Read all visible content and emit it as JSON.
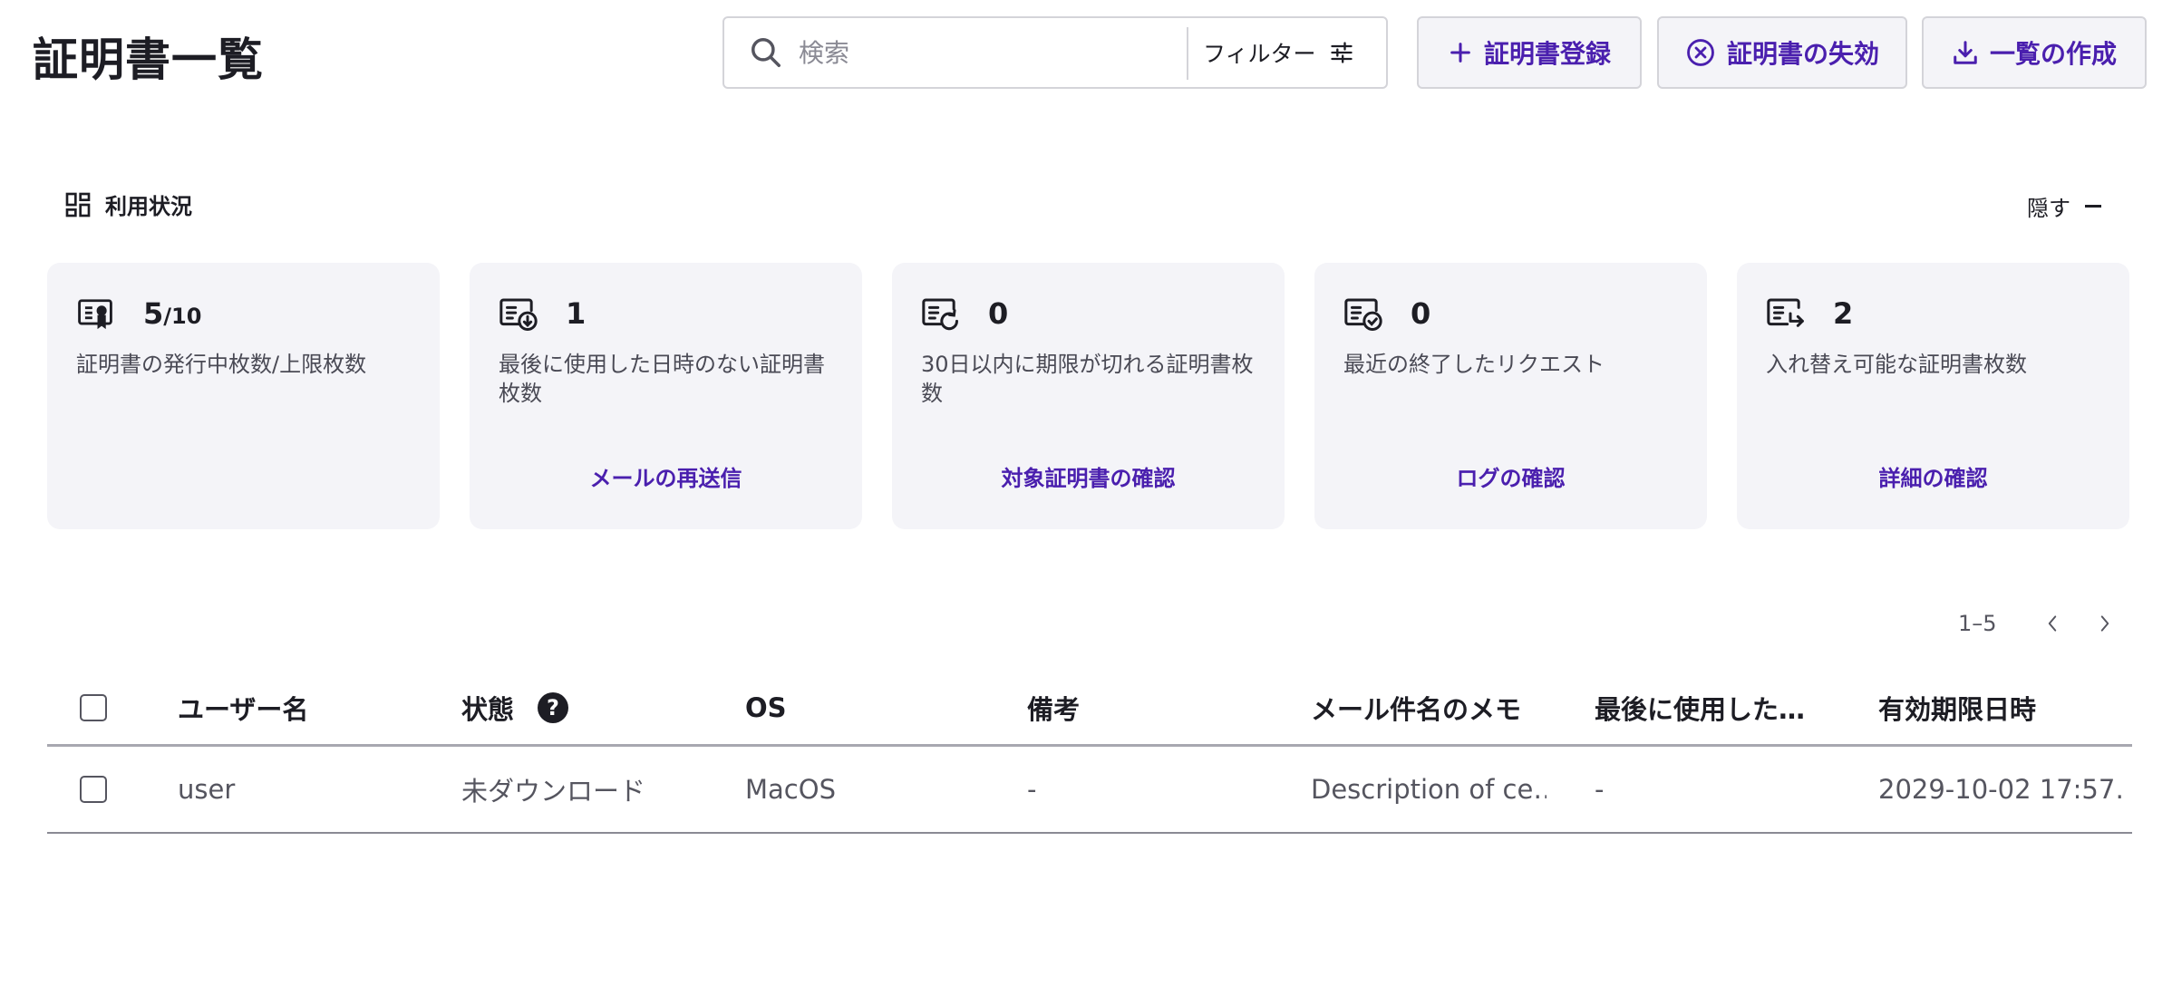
{
  "page": {
    "title": "証明書一覧"
  },
  "search": {
    "placeholder": "検索",
    "value": ""
  },
  "filter": {
    "label": "フィルター"
  },
  "actions": {
    "register_label": "証明書登録",
    "revoke_label": "証明書の失効",
    "export_label": "一覧の作成"
  },
  "usage": {
    "title": "利用状況",
    "hide_label": "隠す",
    "cards": [
      {
        "icon": "certificate-icon",
        "value_main": "5",
        "value_suffix": "/10",
        "description": "証明書の発行中枚数/上限枚数",
        "link": ""
      },
      {
        "icon": "certificate-download-icon",
        "value_main": "1",
        "value_suffix": "",
        "description": "最後に使用した日時のない証明書枚数",
        "link": "メールの再送信"
      },
      {
        "icon": "certificate-renew-icon",
        "value_main": "0",
        "value_suffix": "",
        "description": "30日以内に期限が切れる証明書枚数",
        "link": "対象証明書の確認"
      },
      {
        "icon": "certificate-check-icon",
        "value_main": "0",
        "value_suffix": "",
        "description": "最近の終了したリクエスト",
        "link": "ログの確認"
      },
      {
        "icon": "certificate-replace-icon",
        "value_main": "2",
        "value_suffix": "",
        "description": "入れ替え可能な証明書枚数",
        "link": "詳細の確認"
      }
    ]
  },
  "pagination": {
    "range": "1–5"
  },
  "table": {
    "headers": [
      "ユーザー名",
      "状態",
      "OS",
      "備考",
      "メール件名のメモ",
      "最後に使用した…",
      "有効期限日時"
    ],
    "rows": [
      [
        "user",
        "未ダウンロード",
        "MacOS",
        "-",
        "Description of ce…",
        "-",
        "2029-10-02 17:57…"
      ]
    ]
  },
  "colors": {
    "accent": "#4a1fae",
    "card_bg": "#f4f4f8",
    "border": "#d4d4d9"
  }
}
